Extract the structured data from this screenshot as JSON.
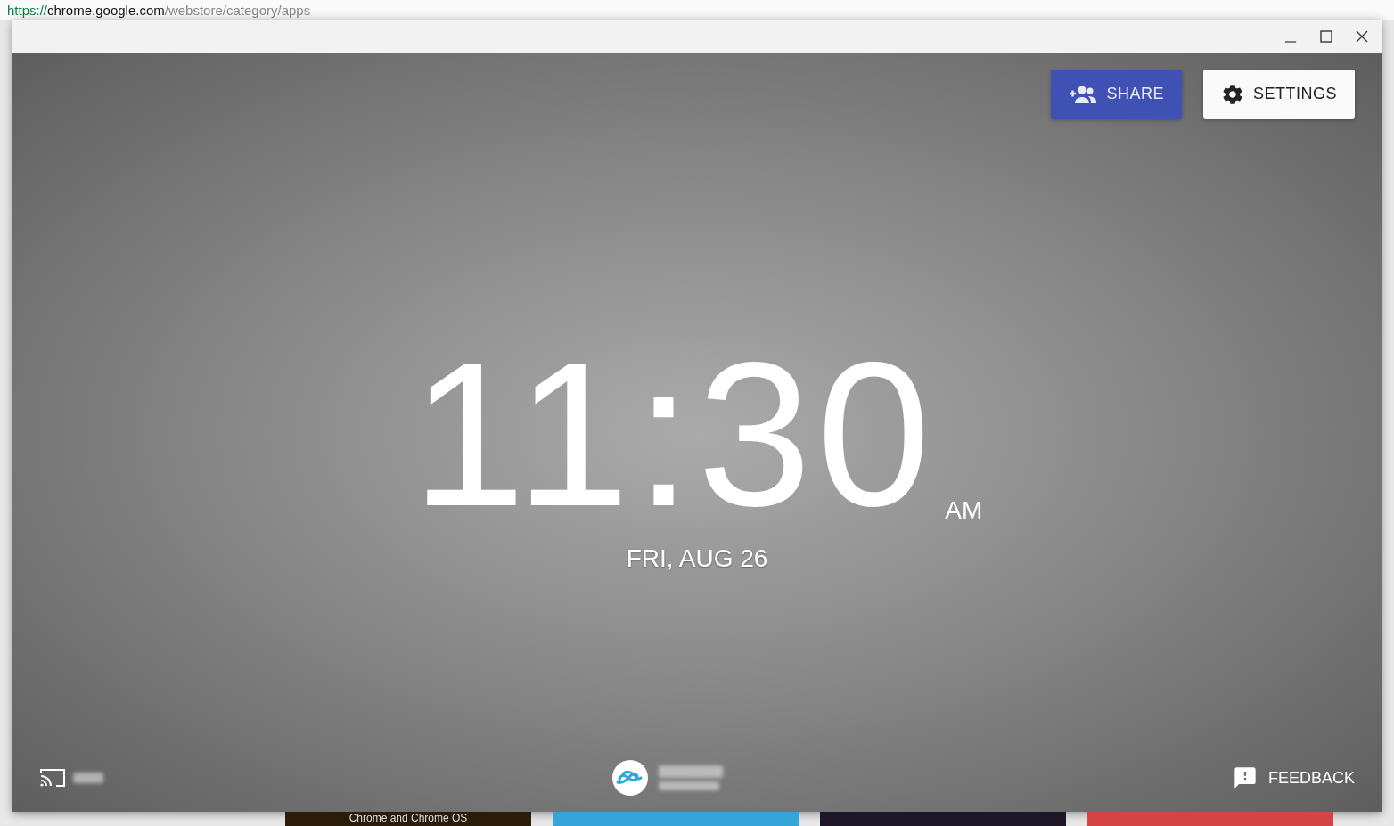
{
  "browser_background": {
    "url": {
      "scheme": "https://",
      "host": "chrome.google.com",
      "path": "/webstore/category/apps"
    },
    "tile_caption": "Chrome and Chrome OS"
  },
  "toolbar": {
    "share_button": "SHARE",
    "settings_button": "SETTINGS"
  },
  "clock": {
    "time": "11:30",
    "period": "AM",
    "date": "FRI, AUG 26"
  },
  "footer": {
    "feedback_button": "FEEDBACK"
  }
}
